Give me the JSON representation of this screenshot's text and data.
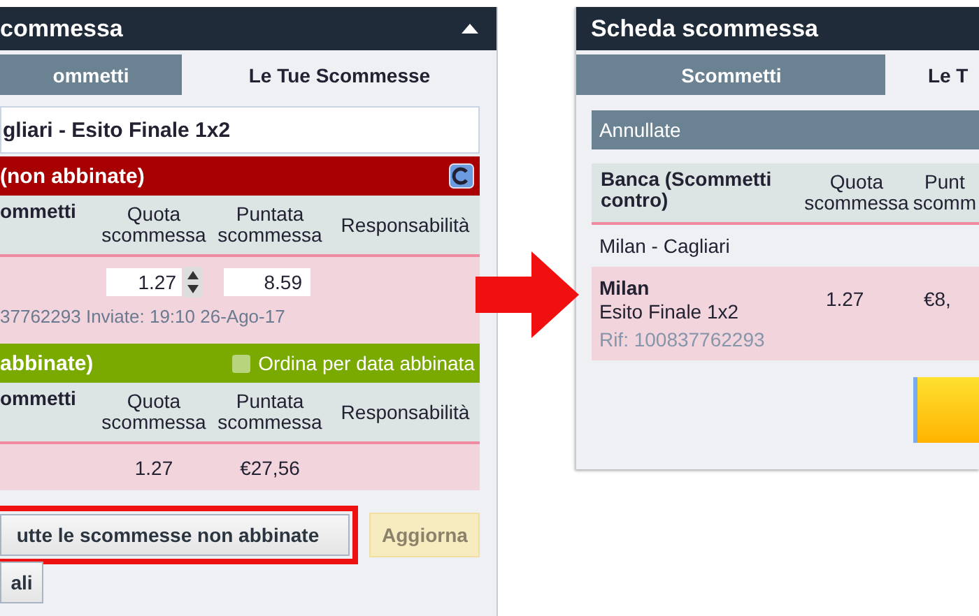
{
  "left_panel": {
    "title": "commessa",
    "tabs": [
      {
        "label": "ommetti",
        "selected": false
      },
      {
        "label": "Le Tue Scommesse",
        "selected": true
      }
    ],
    "event_title": "gliari - Esito Finale 1x2",
    "unmatched": {
      "title": "(non abbinate)",
      "columns": [
        "ommetti",
        "Quota scommessa",
        "Puntata scommessa",
        "Responsabilità"
      ],
      "odds": "1.27",
      "stake": "8.59",
      "info": "37762293 Inviate: 19:10 26-Ago-17"
    },
    "matched": {
      "title": "abbinate)",
      "sort_option": {
        "label": "Ordina per data abbinata",
        "checked": false
      },
      "columns": [
        "ommetti",
        "Quota scommessa",
        "Puntata scommessa",
        "Responsabilità"
      ],
      "odds": "1.27",
      "stake": "€27,56"
    },
    "buttons": [
      {
        "label": "utte le scommesse non abbinate",
        "disabled": false,
        "highlighted": true
      },
      {
        "label": "Aggiorna",
        "disabled": true,
        "highlighted": false
      }
    ],
    "details_button": "ali"
  },
  "right_panel": {
    "title": "Scheda scommessa",
    "tabs": [
      {
        "label": "Scommetti",
        "selected": false
      },
      {
        "label": "Le T",
        "selected": true
      }
    ],
    "section": "Annullate",
    "columns": [
      "Banca (Scommetti contro)",
      "Quota scommessa",
      "Punt scomm"
    ],
    "event": "Milan - Cagliari",
    "bet": {
      "selection": "Milan",
      "market": "Esito Finale 1x2",
      "ref": "Rif: 100837762293",
      "odds": "1.27",
      "stake": "€8,"
    }
  }
}
